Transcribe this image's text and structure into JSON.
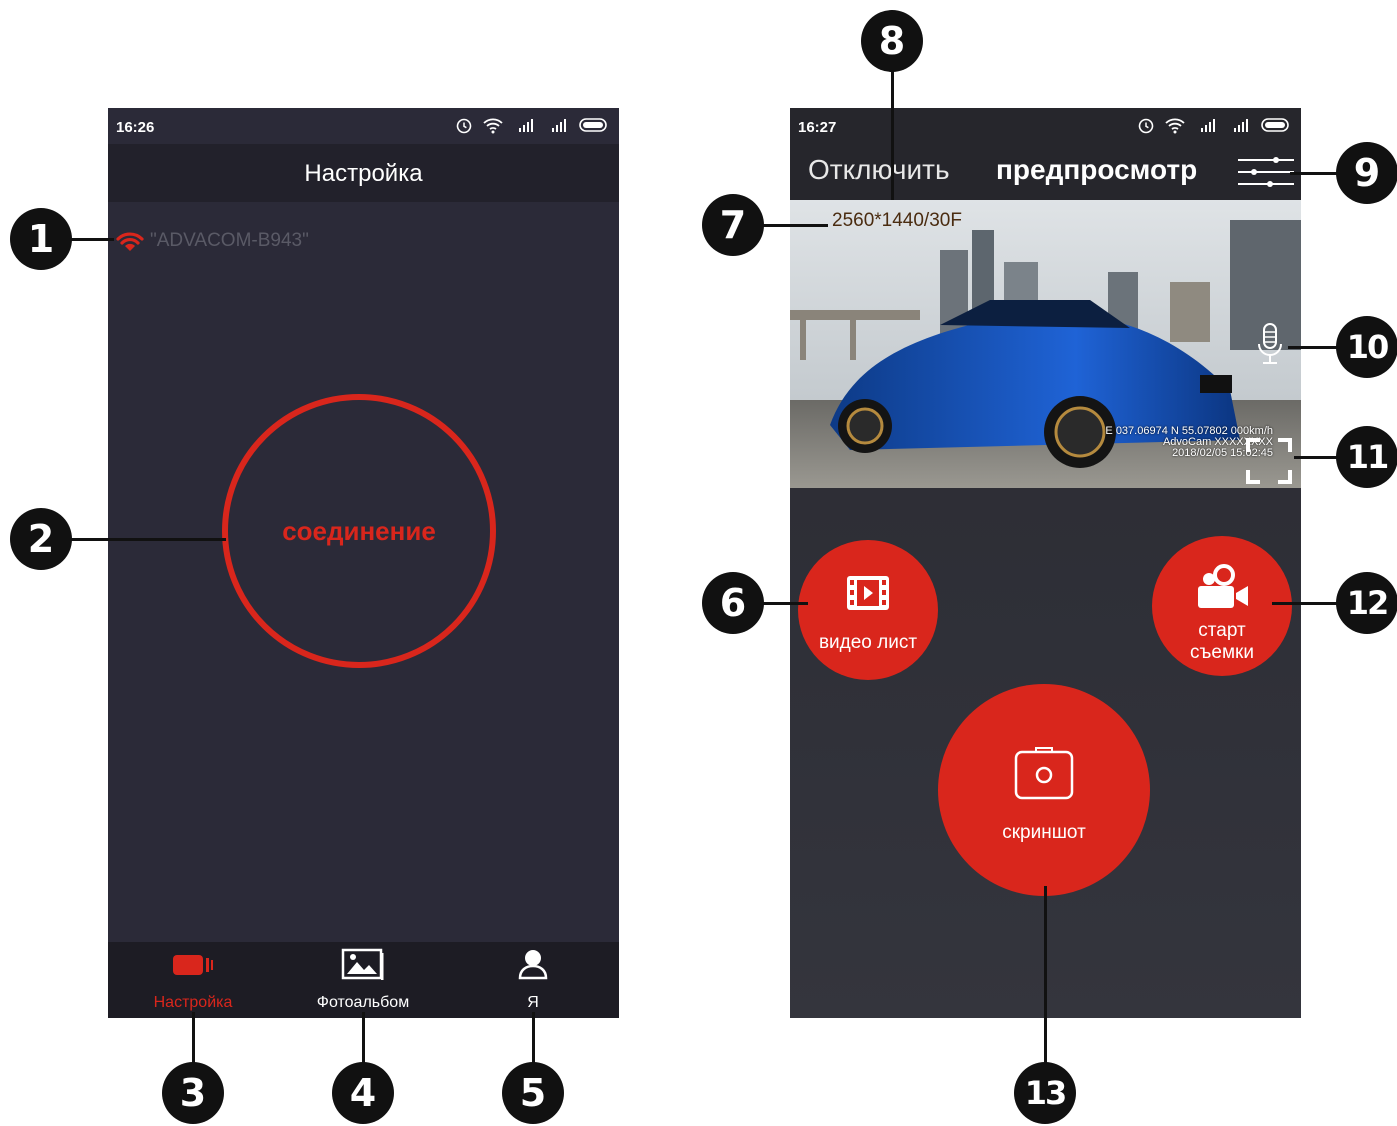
{
  "left_screen": {
    "status_time": "16:26",
    "title": "Настройка",
    "wifi_name": "\"ADVACOM-B943\"",
    "connect_label": "соединение",
    "tabs": [
      {
        "label": "Настройка",
        "icon": "camera-icon",
        "active": true
      },
      {
        "label": "Фотоальбом",
        "icon": "photo-album-icon",
        "active": false
      },
      {
        "label": "Я",
        "icon": "person-icon",
        "active": false
      }
    ]
  },
  "right_screen": {
    "status_time": "16:27",
    "disconnect_label": "Отключить",
    "title": "предпросмотр",
    "resolution": "2560*1440/30F",
    "osd_line1": "E 037.06974 N 55.07802 000km/h",
    "osd_line2": "AdvoCam  XXXXXXXX",
    "osd_line3": "2018/02/05  15:02:45",
    "video_list_label": "видео лист",
    "record_label_1": "старт",
    "record_label_2": "съемки",
    "screenshot_label": "скриншот"
  },
  "callouts": [
    "1",
    "2",
    "3",
    "4",
    "5",
    "6",
    "7",
    "8",
    "9",
    "10",
    "11",
    "12",
    "13"
  ],
  "colors": {
    "accent": "#d9261c",
    "screen_bg": "#2b2a38",
    "tabbar_bg": "#1d1c24",
    "callout": "#111111"
  }
}
